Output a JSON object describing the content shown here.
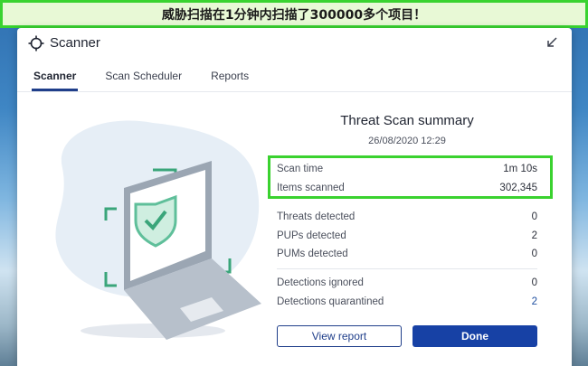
{
  "banner": {
    "caption": "威胁扫描在1分钟内扫描了300000多个项目！"
  },
  "window": {
    "title": "Scanner",
    "title_icon": "crosshair-icon",
    "minimize_icon": "arrow-down-left-icon"
  },
  "tabs": [
    {
      "label": "Scanner",
      "active": true
    },
    {
      "label": "Scan Scheduler",
      "active": false
    },
    {
      "label": "Reports",
      "active": false
    }
  ],
  "summary": {
    "title": "Threat Scan summary",
    "date": "26/08/2020 12:29",
    "scan_time": {
      "label": "Scan time",
      "value": "1m 10s"
    },
    "items_scanned": {
      "label": "Items scanned",
      "value": "302,345"
    },
    "threats": {
      "label": "Threats detected",
      "value": "0"
    },
    "pups": {
      "label": "PUPs detected",
      "value": "2"
    },
    "pums": {
      "label": "PUMs detected",
      "value": "0"
    },
    "ignored": {
      "label": "Detections ignored",
      "value": "0"
    },
    "quarantined": {
      "label": "Detections quarantined",
      "value": "2"
    }
  },
  "buttons": {
    "view_report": "View report",
    "done": "Done"
  },
  "colors": {
    "highlight": "#3ad22f",
    "brand": "#1741a5",
    "shield": "#5fbf9a"
  }
}
